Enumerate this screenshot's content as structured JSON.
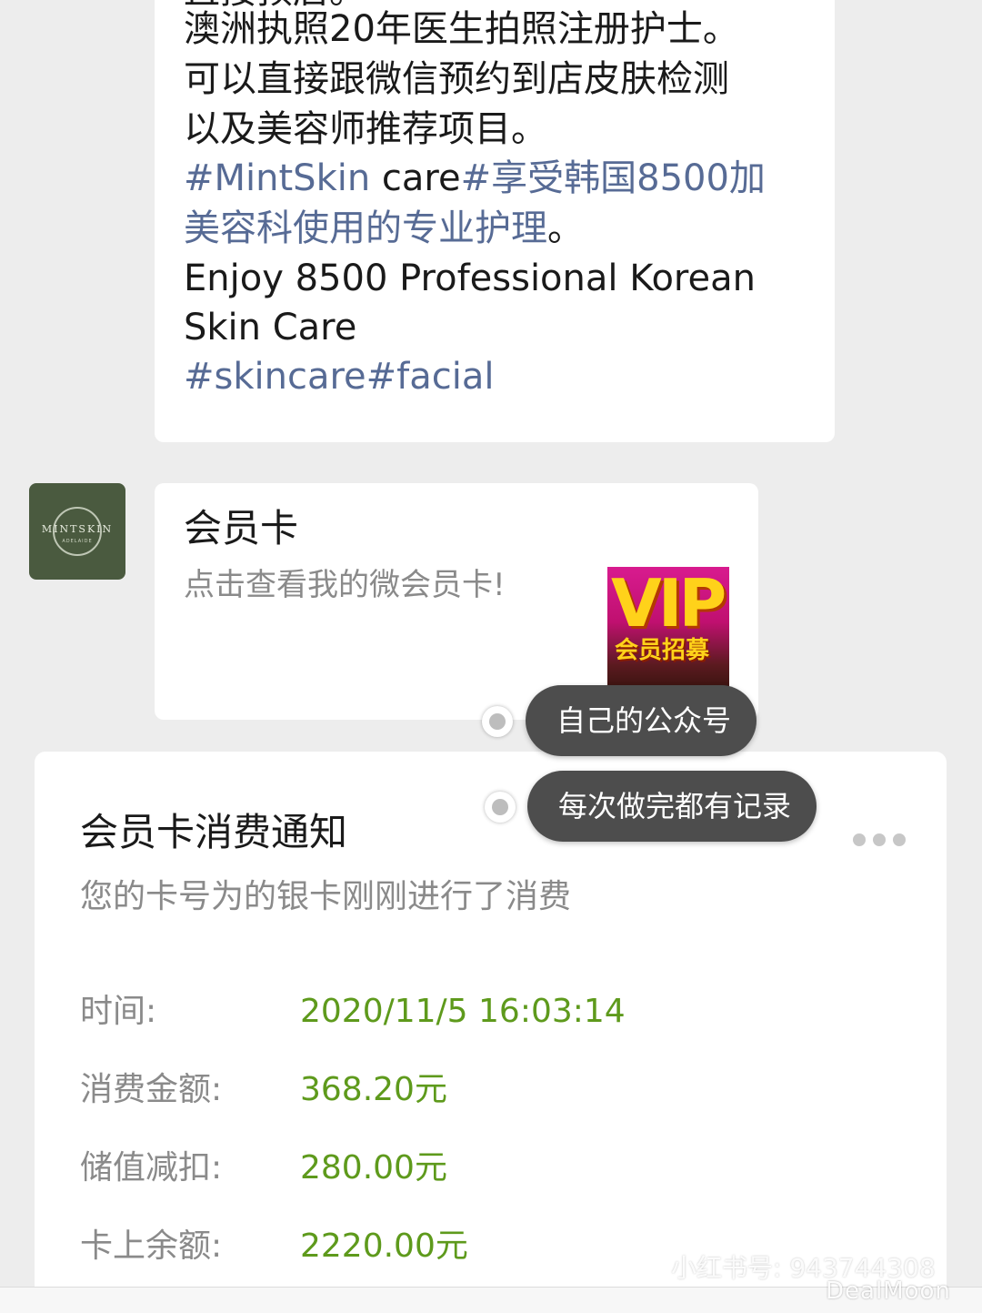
{
  "message": {
    "lines": [
      "直接预店。",
      "澳洲执照20年医生拍照注册护士。",
      "可以直接跟微信预约到店皮肤检测",
      "以及美容师推荐项目。"
    ],
    "hashtag_line": {
      "tag1": "#MintSkin",
      "plain": " care",
      "tag2": "#享受韩国8500加"
    },
    "hashtag_line2": {
      "tag": "美容科使用的专业护理",
      "plain": "。"
    },
    "english_lines": [
      "Enjoy 8500 Professional Korean",
      "Skin Care"
    ],
    "hashtags_last": "#skincare#facial"
  },
  "avatar": {
    "logo_text": "MINTSKIN",
    "logo_sub": "ADELAIDE"
  },
  "member_card": {
    "title": "会员卡",
    "description": "点击查看我的微会员卡!",
    "thumb_word": "VIP",
    "thumb_caption": "会员招募"
  },
  "annotations": [
    "自己的公众号",
    "每次做完都有记录"
  ],
  "notice": {
    "title": "会员卡消费通知",
    "subtitle": "您的卡号为的银卡刚刚进行了消费",
    "rows": [
      {
        "label": "时间:",
        "value": "2020/11/5 16:03:14"
      },
      {
        "label": "消费金额:",
        "value": "368.20元"
      },
      {
        "label": "储值减扣:",
        "value": "280.00元"
      },
      {
        "label": "卡上余额:",
        "value": "2220.00元"
      }
    ],
    "more_icon": "more-horizontal-icon"
  },
  "watermarks": {
    "badge": "小红书",
    "id_text": "小红书号: 943744308",
    "brand": "DealMoon"
  },
  "colors": {
    "background": "#ededed",
    "bubble": "#ffffff",
    "hashtag": "#576b95",
    "value_green": "#5e9a1c",
    "secondary_text": "#8a8a8a",
    "pill": "#4d4d4d"
  }
}
